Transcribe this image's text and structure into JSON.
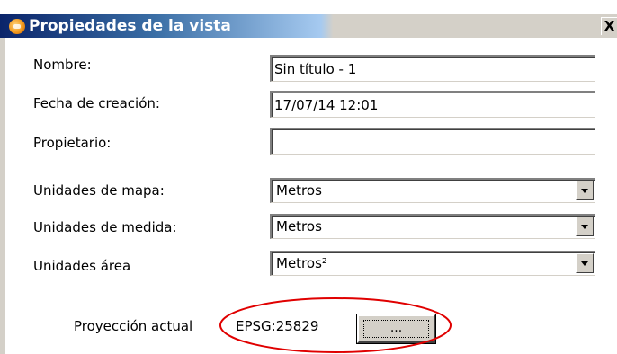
{
  "window": {
    "title": "Propiedades de la vista",
    "close_label": "X"
  },
  "form": {
    "nombre_label": "Nombre:",
    "nombre_value": "Sin título - 1",
    "fecha_label": "Fecha de creación:",
    "fecha_value": "17/07/14 12:01",
    "propietario_label": "Propietario:",
    "propietario_value": "",
    "unidades_mapa_label": "Unidades de mapa:",
    "unidades_mapa_value": "Metros",
    "unidades_medida_label": "Unidades de medida:",
    "unidades_medida_value": "Metros",
    "unidades_area_label": "Unidades área",
    "unidades_area_value": "Metros²"
  },
  "projection": {
    "label": "Proyección actual",
    "value": "EPSG:25829",
    "button_label": "..."
  },
  "colors": {
    "title_gradient_start": "#0a246a",
    "title_gradient_mid": "#a6caf0",
    "highlight": "#e00000"
  },
  "icons": {
    "app": "gvsig-app-icon",
    "close": "close-icon",
    "dropdown": "chevron-down-icon"
  }
}
